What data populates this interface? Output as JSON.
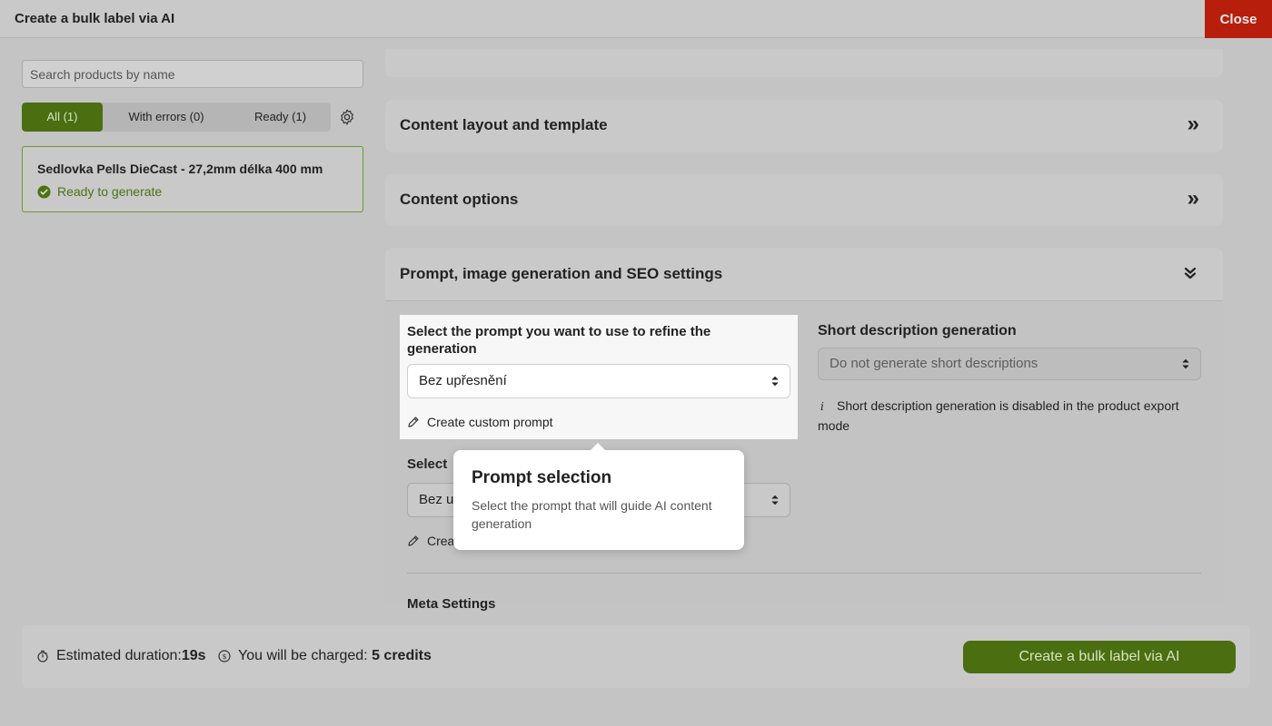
{
  "window": {
    "title": "Create a bulk label via AI",
    "close_label": "Close"
  },
  "sidebar": {
    "search_placeholder": "Search products by name",
    "filters": [
      {
        "label": "All (1)",
        "active": true
      },
      {
        "label": "With errors (0)",
        "active": false
      },
      {
        "label": "Ready (1)",
        "active": false
      }
    ],
    "settings_icon": "gear-icon",
    "products": [
      {
        "name": "Sedlovka Pells DieCast - 27,2mm délka 400 mm",
        "status": "Ready to generate"
      }
    ]
  },
  "sections": {
    "content_layout": {
      "title": "Content layout and template"
    },
    "content_options": {
      "title": "Content options"
    },
    "seo": {
      "title": "Prompt, image generation and SEO settings",
      "prompt_label": "Select the prompt you want to use to refine the generation",
      "prompt_value": "Bez upřesnění",
      "custom_prompt_link": "Create custom prompt",
      "second_prompt_label": "Select",
      "second_prompt_value": "Bez u",
      "second_custom_link": "Creat",
      "meta_label": "Meta Settings",
      "short_desc_label": "Short description generation",
      "short_desc_value": "Do not generate short descriptions",
      "short_desc_note": "Short description generation is disabled in the product export mode"
    }
  },
  "tooltip": {
    "title": "Prompt selection",
    "text": "Select the prompt that will guide AI content generation"
  },
  "footer": {
    "duration_label": "Estimated duration:",
    "duration_value": "19s",
    "charge_label": "You will be charged:",
    "charge_value": "5 credits",
    "cta_label": "Create a bulk label via AI"
  },
  "colors": {
    "accent": "#4a6e10",
    "danger": "#b81e0c",
    "success": "#4a7316"
  }
}
